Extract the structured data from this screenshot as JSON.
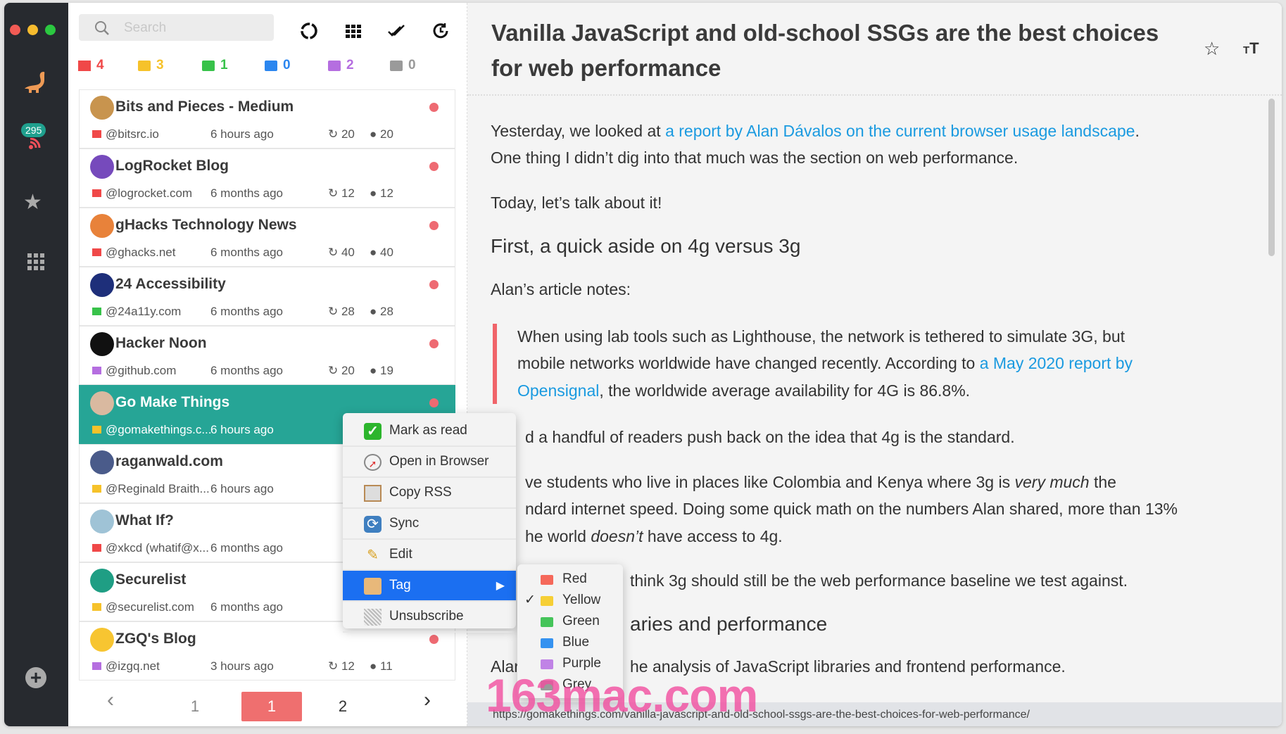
{
  "sidebar": {
    "unread_badge": "295",
    "icons": [
      "dinosaur-logo",
      "rss-icon",
      "star-icon",
      "grid-icon",
      "add-icon"
    ]
  },
  "search": {
    "placeholder": "Search"
  },
  "toolbar": {
    "icons": [
      "refresh-icon",
      "grid-icon",
      "mark-all-read-icon",
      "history-icon"
    ]
  },
  "filters": [
    {
      "name": "red",
      "count": "4",
      "color": "#f04848"
    },
    {
      "name": "yellow",
      "count": "3",
      "color": "#f6c22a"
    },
    {
      "name": "green",
      "count": "1",
      "color": "#38c24a"
    },
    {
      "name": "blue",
      "count": "0",
      "color": "#2b86ef"
    },
    {
      "name": "purple",
      "count": "2",
      "color": "#b56ee0"
    },
    {
      "name": "grey",
      "count": "0",
      "color": "#9a9a9a"
    }
  ],
  "feeds": [
    {
      "title": "Bits and Pieces - Medium",
      "source": "@bitsrc.io",
      "time": "6 hours ago",
      "sync": "20",
      "unread": "20",
      "tag": "red",
      "avatar": "#c8944e"
    },
    {
      "title": "LogRocket Blog",
      "source": "@logrocket.com",
      "time": "6 months ago",
      "sync": "12",
      "unread": "12",
      "tag": "red",
      "avatar": "#764abc"
    },
    {
      "title": "gHacks Technology News",
      "source": "@ghacks.net",
      "time": "6 months ago",
      "sync": "40",
      "unread": "40",
      "tag": "red",
      "avatar": "#e8823a"
    },
    {
      "title": "24 Accessibility",
      "source": "@24a11y.com",
      "time": "6 months ago",
      "sync": "28",
      "unread": "28",
      "tag": "green",
      "avatar": "#1e2f7a"
    },
    {
      "title": "Hacker Noon",
      "source": "@github.com",
      "time": "6 months ago",
      "sync": "20",
      "unread": "19",
      "tag": "purple",
      "avatar": "#111111"
    },
    {
      "title": "Go Make Things",
      "source": "@gomakethings.c...",
      "time": "6 hours ago",
      "sync": "",
      "unread": "",
      "tag": "yellow",
      "avatar": "#d9b9a0",
      "selected": true
    },
    {
      "title": "raganwald.com",
      "source": "@Reginald Braith...",
      "time": "6 hours ago",
      "sync": "",
      "unread": "",
      "tag": "yellow",
      "avatar": "#4a5b8a"
    },
    {
      "title": "What If?",
      "source": "@xkcd (whatif@x...",
      "time": "6 months ago",
      "sync": "",
      "unread": "",
      "tag": "red",
      "avatar": "#9fc3d6"
    },
    {
      "title": "Securelist",
      "source": "@securelist.com",
      "time": "6 months ago",
      "sync": "",
      "unread": "",
      "tag": "yellow",
      "avatar": "#1f9e84"
    },
    {
      "title": "ZGQ's Blog",
      "source": "@izgq.net",
      "time": "3 hours ago",
      "sync": "12",
      "unread": "11",
      "tag": "purple",
      "avatar": "#f7c531"
    }
  ],
  "pagination": {
    "prev": "‹",
    "pages": [
      "1",
      "1",
      "2"
    ],
    "active_index": 1,
    "next": "›"
  },
  "article": {
    "title": "Vanilla JavaScript and old-school SSGs are the best choices for web performance",
    "p1_pre": "Yesterday, we looked at ",
    "p1_link": "a report by Alan Dávalos on the current browser usage landscape",
    "p1_post": ".",
    "p1_line2": "One thing I didn’t dig into that much was the section on web performance.",
    "p2": "Today, let’s talk about it!",
    "h1": "First, a quick aside on 4g versus 3g",
    "p3": "Alan’s article notes:",
    "bq1": "When using lab tools such as Lighthouse, the network is tethered to simulate 3G, but",
    "bq2_pre": "mobile networks worldwide have changed recently. According to ",
    "bq2_link": "a May 2020 report by",
    "bq3_link": "Opensignal",
    "bq3_post": ", the worldwide average availability for 4G is 86.8%.",
    "frag1": "d a handful of readers push back on the idea that 4g is the standard.",
    "frag2_pre": "ve students who live in places like Colombia and Kenya where 3g is ",
    "frag2_em": "very much",
    "frag2_post": " the",
    "frag3": "ndard internet speed. Doing some quick math on the numbers Alan shared, more than 13%",
    "frag4_pre": "he world ",
    "frag4_em": "doesn’t",
    "frag4_post": " have access to 4g.",
    "frag5": "think 3g should still be the web performance baseline we test against.",
    "frag6": "aries and performance",
    "frag7a": "Alar",
    "frag7b": "he analysis of JavaScript libraries and frontend performance.",
    "status_url": "https://gomakethings.com/vanilla-javascript-and-old-school-ssgs-are-the-best-choices-for-web-performance/"
  },
  "context_menu": {
    "items": [
      {
        "label": "Mark as read",
        "icon": "check-icon"
      },
      {
        "label": "Open in Browser",
        "icon": "compass-icon"
      },
      {
        "label": "Copy RSS",
        "icon": "clipboard-icon"
      },
      {
        "label": "Sync",
        "icon": "sync-icon"
      },
      {
        "label": "Edit",
        "icon": "pencil-icon"
      },
      {
        "label": "Tag",
        "icon": "tag-box-icon",
        "highlighted": true,
        "submenu": true
      },
      {
        "label": "Unsubscribe",
        "icon": "trash-icon"
      }
    ]
  },
  "tag_submenu": {
    "items": [
      {
        "label": "Red",
        "color": "#f5685a"
      },
      {
        "label": "Yellow",
        "color": "#f6cf35",
        "checked": true
      },
      {
        "label": "Green",
        "color": "#45c45a"
      },
      {
        "label": "Blue",
        "color": "#3592f0"
      },
      {
        "label": "Purple",
        "color": "#c083e6"
      },
      {
        "label": "Grey",
        "color": "#9a9a9a"
      }
    ]
  },
  "watermark": "163mac.com"
}
